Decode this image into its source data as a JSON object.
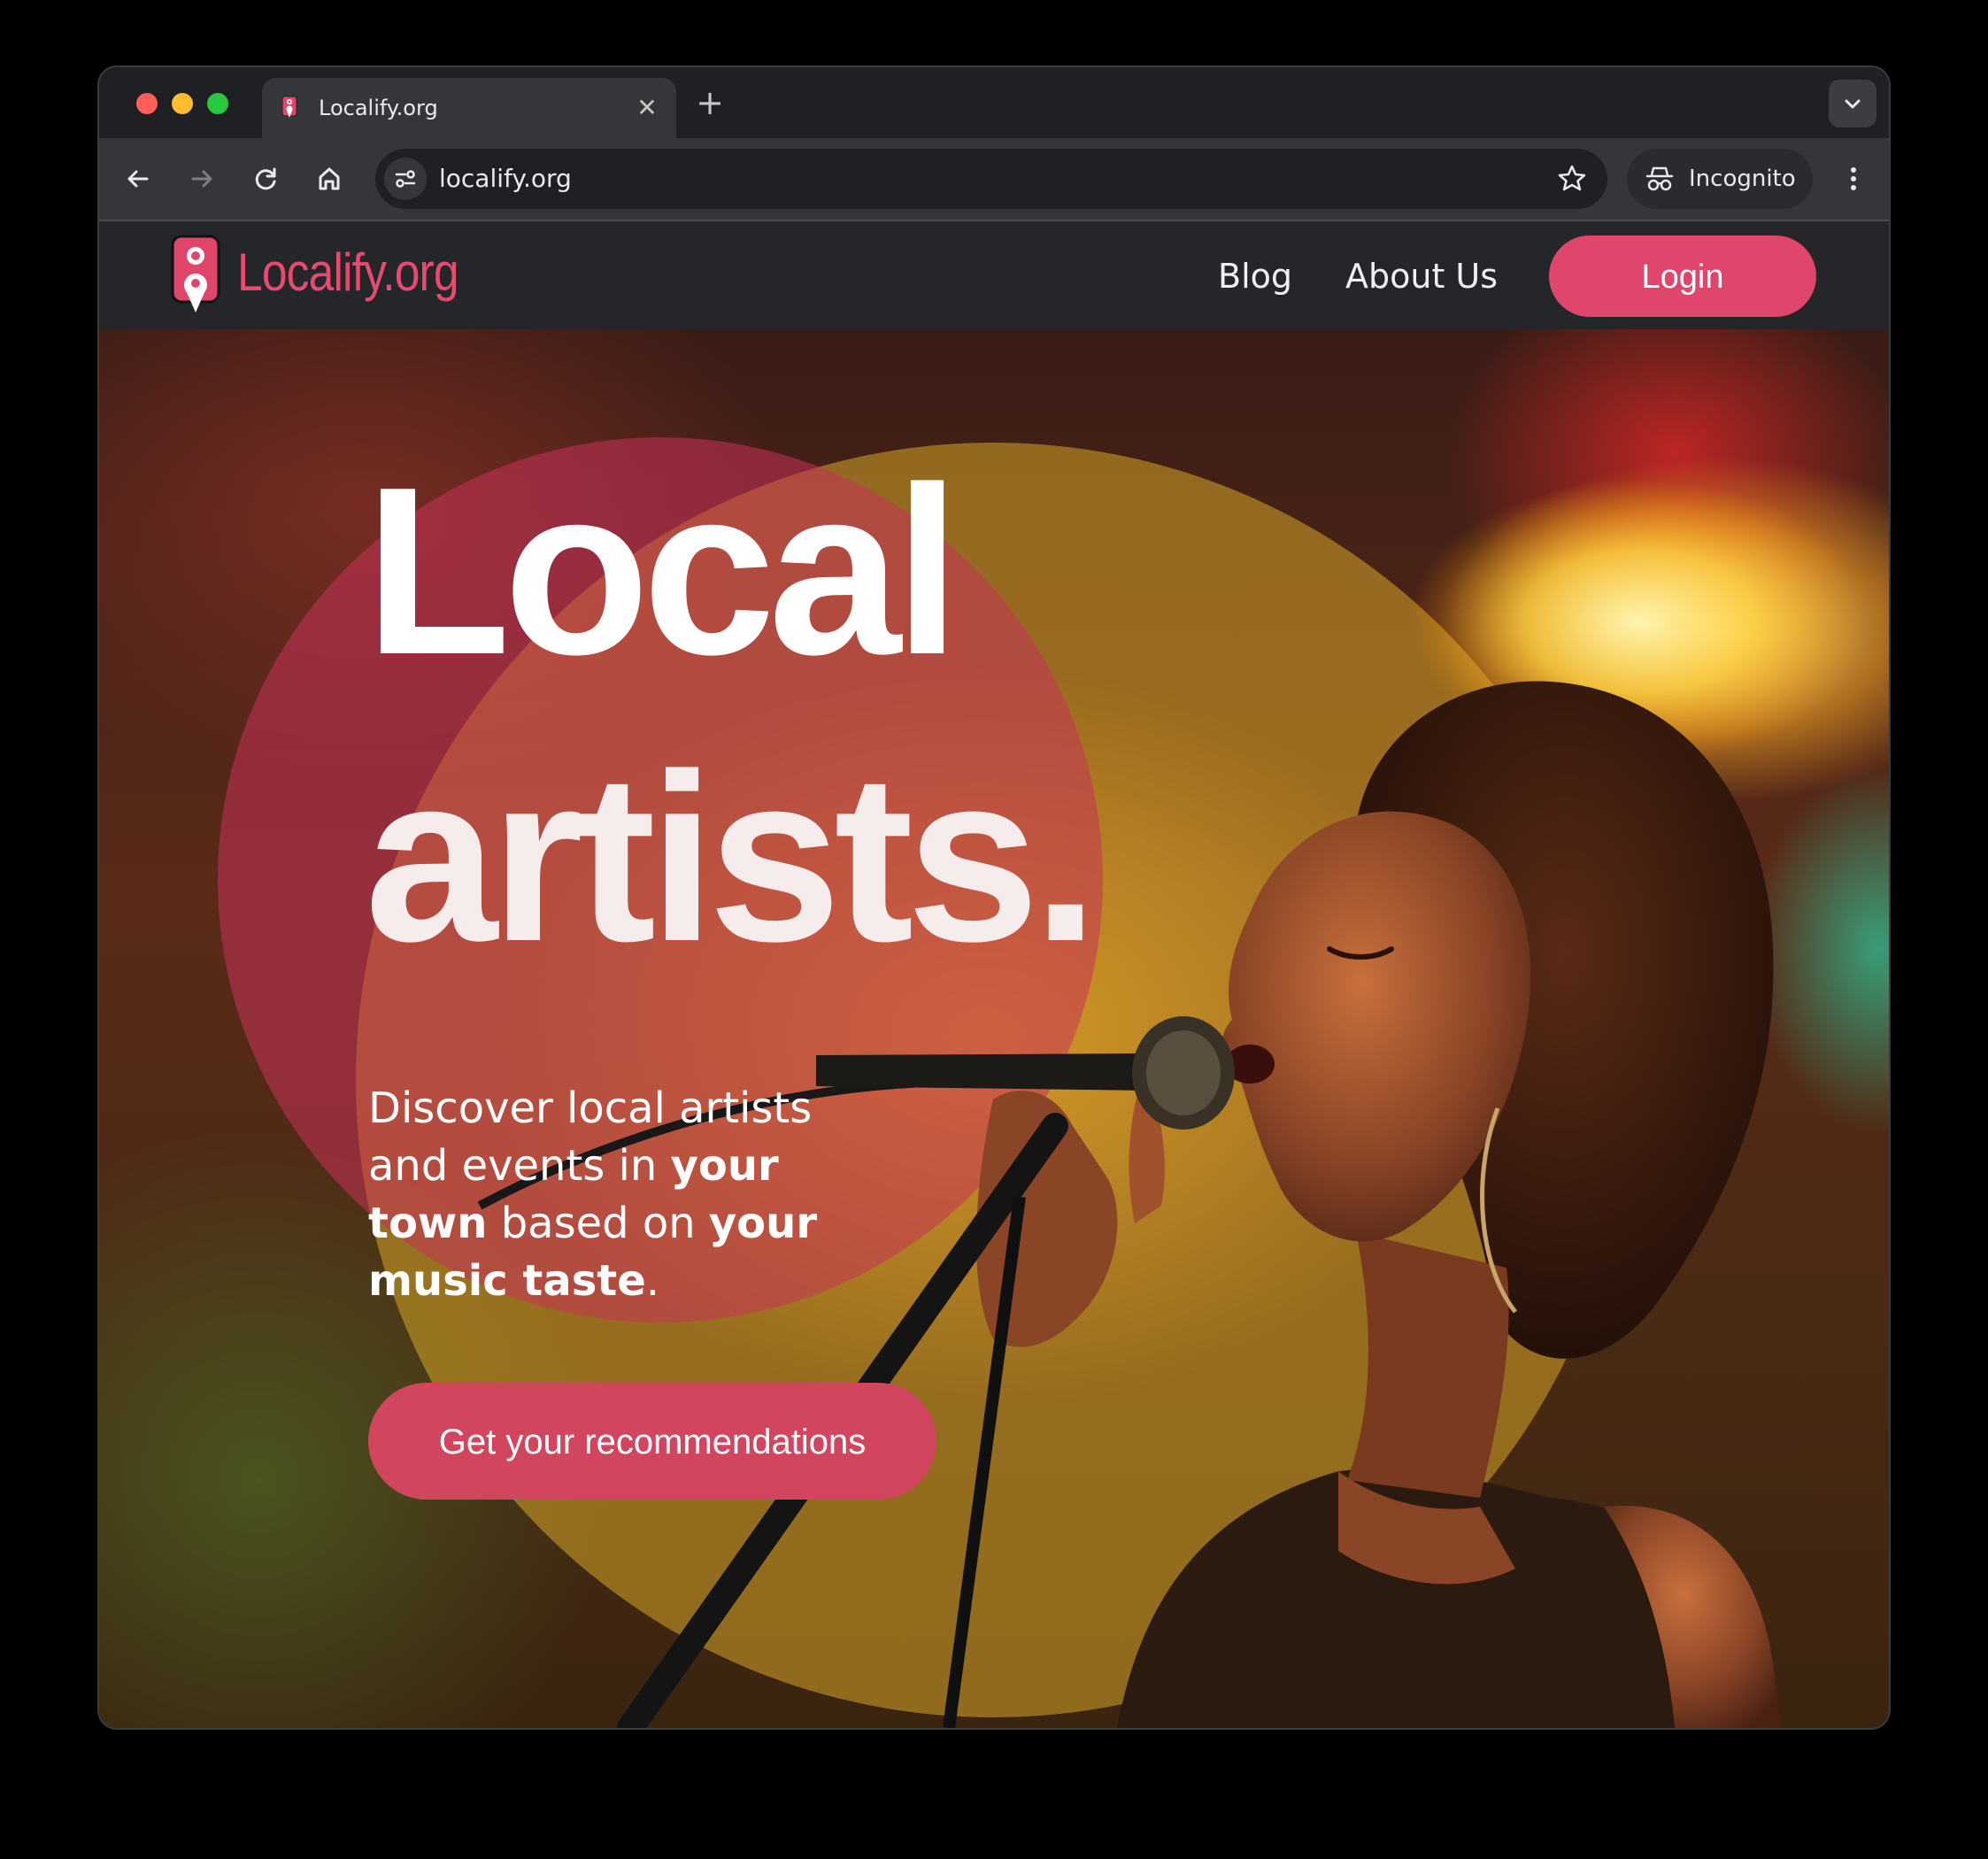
{
  "browser": {
    "tab_title": "Localify.org",
    "new_tab_label": "+",
    "close_tab_label": "✕",
    "url": "localify.org",
    "incognito_label": "Incognito"
  },
  "header": {
    "logo_text": "Localify.org",
    "nav": {
      "blog": "Blog",
      "about": "About Us"
    },
    "login_label": "Login"
  },
  "hero": {
    "headline_line1": "Local",
    "headline_line2": "artists.",
    "subtext": {
      "p1": "Discover local artists and events in ",
      "b1": "your town",
      "p2": " based on ",
      "b2": "your music taste",
      "p3": "."
    },
    "cta_label": "Get your recommendations"
  },
  "colors": {
    "brand_pink": "#e0466c",
    "header_bg": "#25262a",
    "browser_frame": "#1f2023"
  }
}
